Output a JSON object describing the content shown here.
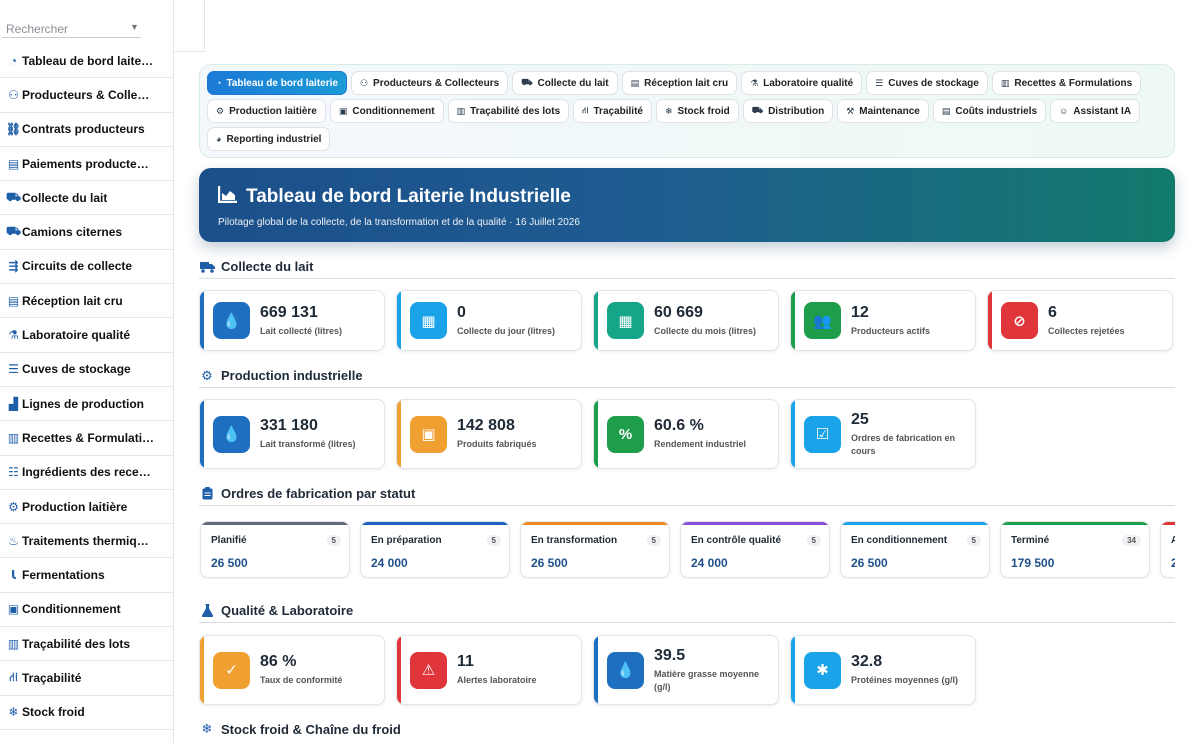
{
  "sidebar": {
    "search_placeholder": "Rechercher",
    "items": [
      {
        "label": "Tableau de bord laite…",
        "icon": "gauge-icon"
      },
      {
        "label": "Producteurs & Colle…",
        "icon": "users-icon"
      },
      {
        "label": "Contrats producteurs",
        "icon": "handshake-icon"
      },
      {
        "label": "Paiements producte…",
        "icon": "money-icon"
      },
      {
        "label": "Collecte du lait",
        "icon": "truck-icon"
      },
      {
        "label": "Camions citernes",
        "icon": "truck-icon"
      },
      {
        "label": "Circuits de collecte",
        "icon": "route-icon"
      },
      {
        "label": "Réception lait cru",
        "icon": "clipboard-icon"
      },
      {
        "label": "Laboratoire qualité",
        "icon": "flask-icon"
      },
      {
        "label": "Cuves de stockage",
        "icon": "database-icon"
      },
      {
        "label": "Lignes de production",
        "icon": "chart-icon"
      },
      {
        "label": "Recettes & Formulati…",
        "icon": "book-icon"
      },
      {
        "label": "Ingrédients des rece…",
        "icon": "list-icon"
      },
      {
        "label": "Production laitière",
        "icon": "gears-icon"
      },
      {
        "label": "Traitements thermiq…",
        "icon": "fire-icon"
      },
      {
        "label": "Fermentations",
        "icon": "thermometer-icon"
      },
      {
        "label": "Conditionnement",
        "icon": "box-icon"
      },
      {
        "label": "Traçabilité des lots",
        "icon": "barcode-icon"
      },
      {
        "label": "Traçabilité",
        "icon": "sitemap-icon"
      },
      {
        "label": "Stock froid",
        "icon": "snowflake-icon"
      }
    ]
  },
  "tabs": [
    {
      "label": "Tableau de bord laiterie",
      "icon": "gauge-icon",
      "active": true
    },
    {
      "label": "Producteurs & Collecteurs",
      "icon": "users-icon"
    },
    {
      "label": "Collecte du lait",
      "icon": "truck-icon"
    },
    {
      "label": "Réception lait cru",
      "icon": "clipboard-icon"
    },
    {
      "label": "Laboratoire qualité",
      "icon": "flask-icon"
    },
    {
      "label": "Cuves de stockage",
      "icon": "database-icon"
    },
    {
      "label": "Recettes & Formulations",
      "icon": "book-icon"
    },
    {
      "label": "Production laitière",
      "icon": "gears-icon"
    },
    {
      "label": "Conditionnement",
      "icon": "box-icon"
    },
    {
      "label": "Traçabilité des lots",
      "icon": "barcode-icon"
    },
    {
      "label": "Traçabilité",
      "icon": "sitemap-icon"
    },
    {
      "label": "Stock froid",
      "icon": "snowflake-icon"
    },
    {
      "label": "Distribution",
      "icon": "dolly-icon"
    },
    {
      "label": "Maintenance",
      "icon": "wrench-icon"
    },
    {
      "label": "Coûts industriels",
      "icon": "money-icon"
    },
    {
      "label": "Assistant IA",
      "icon": "robot-icon"
    },
    {
      "label": "Reporting industriel",
      "icon": "pie-icon"
    }
  ],
  "banner": {
    "title": "Tableau de bord Laiterie Industrielle",
    "subtitle": "Pilotage global de la collecte, de la transformation et de la qualité · 16 Juillet 2026"
  },
  "sections": {
    "collecte": "Collecte du lait",
    "production": "Production industrielle",
    "ordres": "Ordres de fabrication par statut",
    "qualite": "Qualité & Laboratoire",
    "stock": "Stock froid & Chaîne du froid"
  },
  "collecte_cards": [
    {
      "value": "669 131",
      "label": "Lait collecté (litres)",
      "icon": "drop-icon",
      "color": "#1f6fc0",
      "bar": "#1f6fc0"
    },
    {
      "value": "0",
      "label": "Collecte du jour (litres)",
      "icon": "calendar-day-icon",
      "color": "#1aa3e8",
      "bar": "#1aa3e8"
    },
    {
      "value": "60 669",
      "label": "Collecte du mois (litres)",
      "icon": "calendar-icon",
      "color": "#17a589",
      "bar": "#17a589"
    },
    {
      "value": "12",
      "label": "Producteurs actifs",
      "icon": "users-icon",
      "color": "#1e9e4a",
      "bar": "#1e9e4a"
    },
    {
      "value": "6",
      "label": "Collectes rejetées",
      "icon": "ban-icon",
      "color": "#e0353b",
      "bar": "#e0353b"
    }
  ],
  "production_cards": [
    {
      "value": "331 180",
      "label": "Lait transformé (litres)",
      "icon": "drop-icon",
      "color": "#1f6fc0",
      "bar": "#1f6fc0"
    },
    {
      "value": "142 808",
      "label": "Produits fabriqués",
      "icon": "box-icon",
      "color": "#f0a030",
      "bar": "#f0a030"
    },
    {
      "value": "60.6 %",
      "label": "Rendement industriel",
      "icon": "percent-icon",
      "color": "#1e9e4a",
      "bar": "#1e9e4a"
    },
    {
      "value": "25",
      "label": "Ordres de fabrication en cours",
      "icon": "tasks-icon",
      "color": "#1aa3e8",
      "bar": "#1aa3e8"
    }
  ],
  "ordres_status": [
    {
      "name": "Planifié",
      "count": "5",
      "value": "26 500",
      "color": "#5f6b78"
    },
    {
      "name": "En préparation",
      "count": "5",
      "value": "24 000",
      "color": "#1f5fc0"
    },
    {
      "name": "En transformation",
      "count": "5",
      "value": "26 500",
      "color": "#f08a24"
    },
    {
      "name": "En contrôle qualité",
      "count": "5",
      "value": "24 000",
      "color": "#8a4fd8"
    },
    {
      "name": "En conditionnement",
      "count": "5",
      "value": "26 500",
      "color": "#1aa3e8"
    },
    {
      "name": "Terminé",
      "count": "34",
      "value": "179 500",
      "color": "#1e9e4a"
    },
    {
      "name": "A",
      "count": "",
      "value": "2",
      "color": "#e0353b"
    }
  ],
  "qualite_cards": [
    {
      "value": "86 %",
      "label": "Taux de conformité",
      "icon": "check-icon",
      "color": "#f0a030",
      "bar": "#f0a030"
    },
    {
      "value": "11",
      "label": "Alertes laboratoire",
      "icon": "warning-icon",
      "color": "#e0353b",
      "bar": "#e0353b"
    },
    {
      "value": "39.5",
      "label": "Matière grasse moyenne (g/l)",
      "icon": "drop-icon",
      "color": "#1f6fc0",
      "bar": "#1f6fc0"
    },
    {
      "value": "32.8",
      "label": "Protéines moyennes (g/l)",
      "icon": "cog-icon",
      "color": "#1aa3e8",
      "bar": "#1aa3e8"
    }
  ]
}
